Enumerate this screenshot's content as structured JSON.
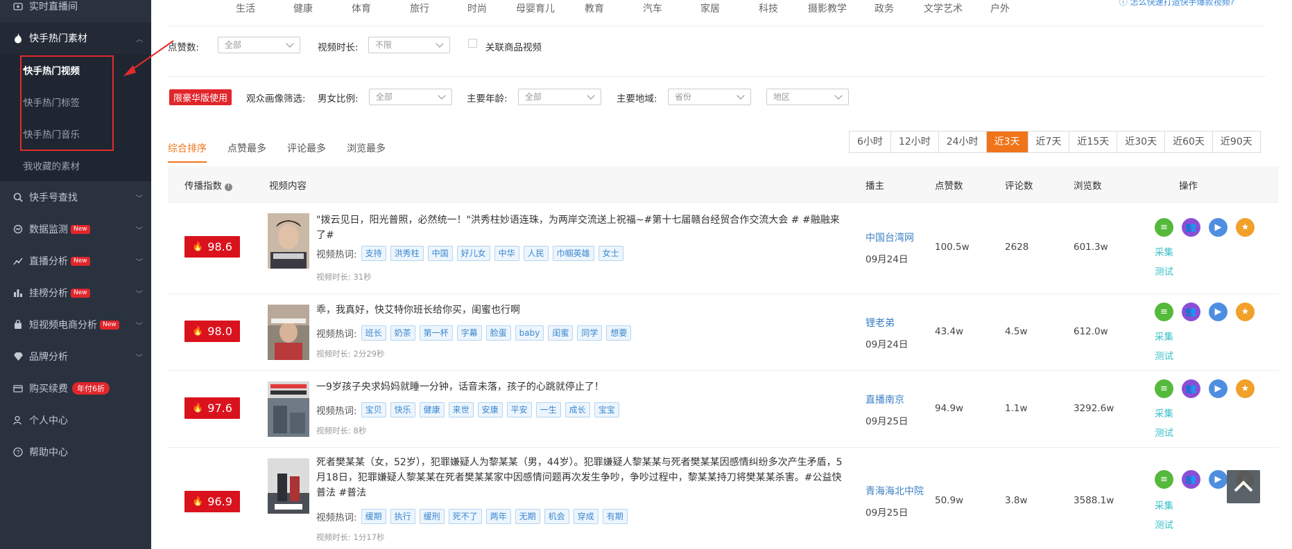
{
  "sidebar": {
    "items": [
      {
        "label": "实时直播间",
        "icon": "live-room-icon"
      },
      {
        "label": "快手热门素材",
        "icon": "fire-icon"
      },
      {
        "label": "快手号查找",
        "icon": "search-icon"
      },
      {
        "label": "数据监测",
        "icon": "monitor-icon",
        "badge": "New"
      },
      {
        "label": "直播分析",
        "icon": "line-chart-icon",
        "badge": "New"
      },
      {
        "label": "挂榜分析",
        "icon": "bar-chart-icon",
        "badge": "New"
      },
      {
        "label": "短视频电商分析",
        "icon": "shopping-bag-icon",
        "badge": "New"
      },
      {
        "label": "品牌分析",
        "icon": "diamond-icon"
      },
      {
        "label": "购买续费",
        "icon": "card-icon",
        "badge": "年付6折"
      },
      {
        "label": "个人中心",
        "icon": "user-icon"
      },
      {
        "label": "帮助中心",
        "icon": "help-icon"
      }
    ],
    "subitems": [
      "快手热门视频",
      "快手热门标签",
      "快手热门音乐",
      "我收藏的素材"
    ]
  },
  "categories": [
    "生活",
    "健康",
    "体育",
    "旅行",
    "时尚",
    "母婴育儿",
    "教育",
    "汽车",
    "家居",
    "科技",
    "摄影教学",
    "政务",
    "文学艺术",
    "户外"
  ],
  "help_link": "怎么快速打造快手爆款视频?",
  "filters": {
    "likes_label": "点赞数:",
    "likes_value": "全部",
    "duration_label": "视频时长:",
    "duration_value": "不限",
    "product_label": "关联商品视频",
    "luxury_badge": "限豪华版使用",
    "audience_label": "观众画像筛选:",
    "gender_label": "男女比例:",
    "gender_value": "全部",
    "age_label": "主要年龄:",
    "age_value": "全部",
    "region_label": "主要地域:",
    "province_placeholder": "省份",
    "area_placeholder": "地区"
  },
  "sort_tabs": [
    "综合排序",
    "点赞最多",
    "评论最多",
    "浏览最多"
  ],
  "time_ranges": [
    "6小时",
    "12小时",
    "24小时",
    "近3天",
    "近7天",
    "近15天",
    "近30天",
    "近60天",
    "近90天"
  ],
  "time_active": "近3天",
  "table": {
    "headers": [
      "传播指数",
      "视频内容",
      "播主",
      "点赞数",
      "评论数",
      "浏览数",
      "操作"
    ],
    "hot_words_label": "视频热词:",
    "duration_prefix": "视频时长:",
    "collect_label": "采集",
    "test_label": "测试",
    "rows": [
      {
        "score": "98.6",
        "title": "\"拨云见日，阳光普照，必然统一！\"洪秀柱妙语连珠，为两岸交流送上祝福~#第十七届赣台经贸合作交流大会 # #融融来了#",
        "tags": [
          "支持",
          "洪秀柱",
          "中国",
          "好儿女",
          "中华",
          "人民",
          "巾帼英雄",
          "女士"
        ],
        "duration": "31秒",
        "anchor": "中国台湾网",
        "date": "09月24日",
        "likes": "100.5w",
        "comments": "2628",
        "views": "601.3w"
      },
      {
        "score": "98.0",
        "title": "乖，我真好，快艾特你班长给你买，闺蜜也行啊",
        "tags": [
          "班长",
          "奶茶",
          "第一杯",
          "字幕",
          "脸蛋",
          "baby",
          "闺蜜",
          "同学",
          "想要"
        ],
        "duration": "2分29秒",
        "anchor": "锂老弟",
        "date": "09月24日",
        "likes": "43.4w",
        "comments": "4.5w",
        "views": "612.0w"
      },
      {
        "score": "97.6",
        "title": "一9岁孩子央求妈妈就睡一分钟，话音未落，孩子的心跳就停止了！",
        "tags": [
          "宝贝",
          "快乐",
          "健康",
          "来世",
          "安康",
          "平安",
          "一生",
          "成长",
          "宝宝"
        ],
        "duration": "8秒",
        "anchor": "直播南京",
        "date": "09月25日",
        "likes": "94.9w",
        "comments": "1.1w",
        "views": "3292.6w"
      },
      {
        "score": "96.9",
        "title": "死者樊某某（女，52岁），犯罪嫌疑人为黎某某（男，44岁）。犯罪嫌疑人黎某某与死者樊某某因感情纠纷多次产生矛盾，5月18日，犯罪嫌疑人黎某某在死者樊某某家中因感情问题再次发生争吵，争吵过程中，黎某某持刀将樊某某杀害。#公益快普法 #普法",
        "tags": [
          "缓期",
          "执行",
          "缓刑",
          "死不了",
          "两年",
          "无期",
          "机会",
          "穿成",
          "有期"
        ],
        "duration": "1分17秒",
        "anchor": "青海海北中院",
        "date": "09月25日",
        "likes": "50.9w",
        "comments": "3.8w",
        "views": "3588.1w"
      }
    ]
  },
  "colors": {
    "sidebar": "#2a3240",
    "accent": "#f0741a",
    "score": "#d9121d",
    "link": "#3b7fc4"
  }
}
